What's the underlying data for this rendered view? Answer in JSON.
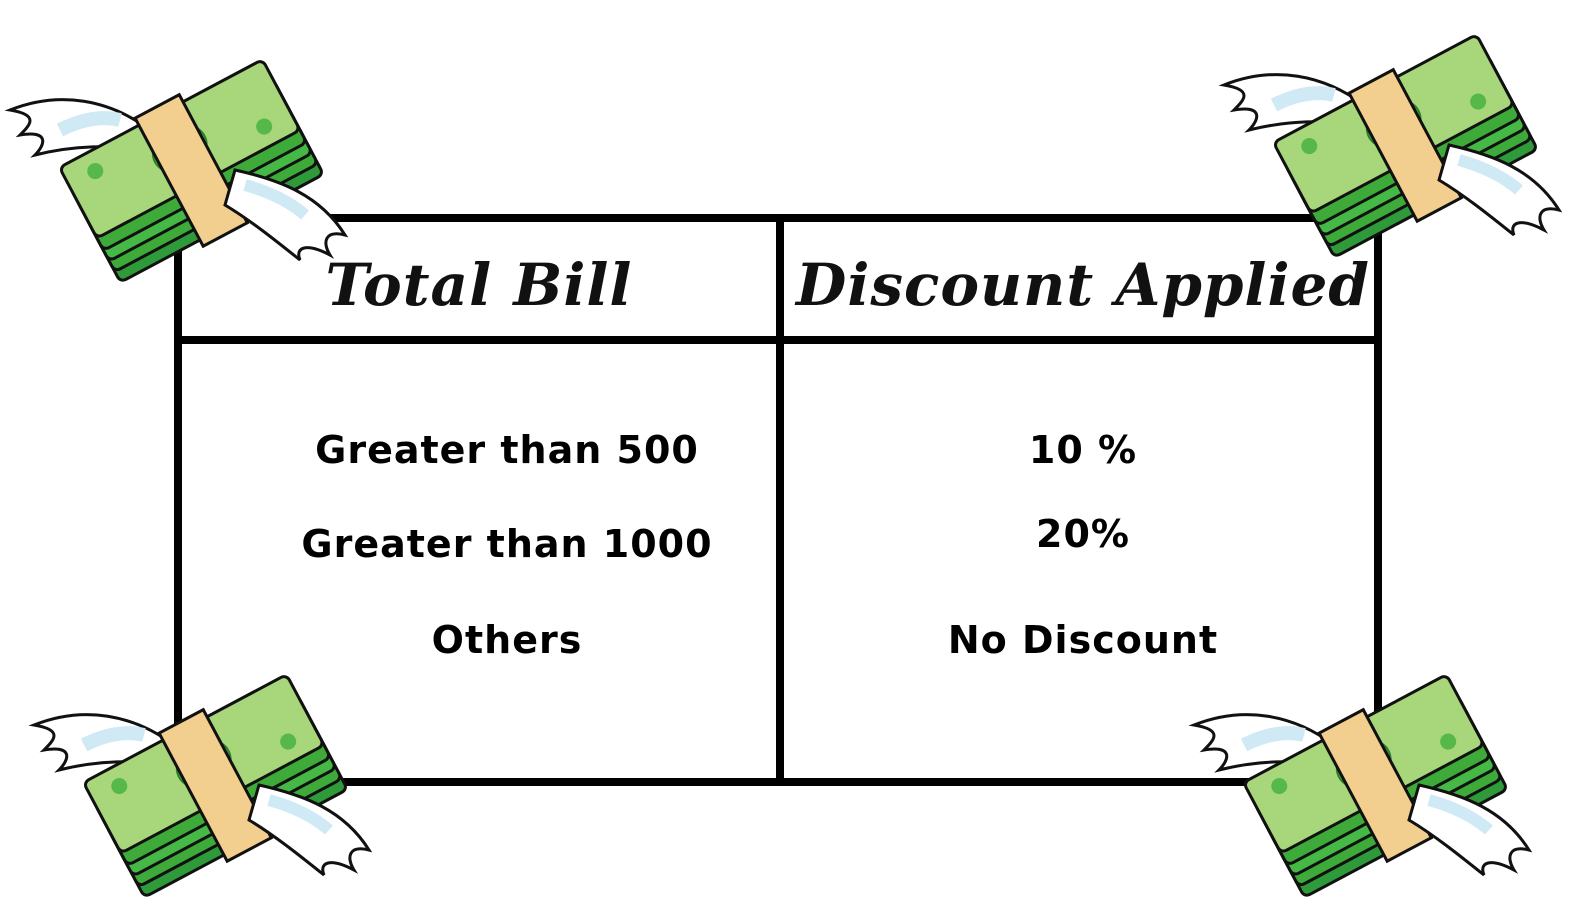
{
  "table": {
    "headers": [
      "Total Bill",
      "Discount Applied"
    ],
    "rows": [
      {
        "bill": "Greater than 500",
        "discount": "10 %"
      },
      {
        "bill": "Greater than 1000",
        "discount": "20%"
      },
      {
        "bill": "Others",
        "discount": "No Discount"
      }
    ]
  },
  "colors": {
    "border": "#000000",
    "cash_dark": "#3daa3a",
    "cash_light": "#a8d67a",
    "band": "#f2cf8e",
    "wing": "#ffffff"
  },
  "icons": [
    "flying-money-icon"
  ]
}
